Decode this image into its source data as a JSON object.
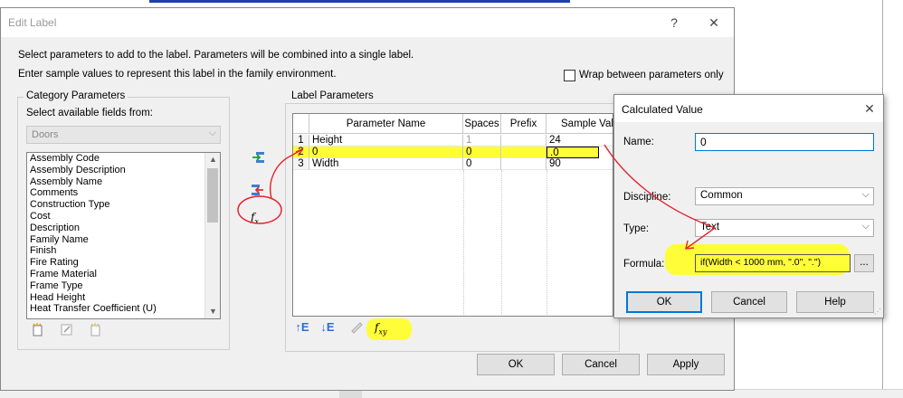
{
  "edit_label": {
    "title": "Edit Label",
    "help_glyph": "?",
    "close_glyph": "✕",
    "instruction1": "Select parameters to add to the label.  Parameters will be combined into a single label.",
    "instruction2": "Enter sample values to represent this label in the family environment.",
    "wrap_label": "Wrap between parameters only",
    "wrap_checked": false,
    "category_group": {
      "title": "Category Parameters",
      "select_label": "Select available fields from:",
      "category_value": "Doors",
      "fields": [
        "Assembly Code",
        "Assembly Description",
        "Assembly Name",
        "Comments",
        "Construction Type",
        "Cost",
        "Description",
        "Family Name",
        "Finish",
        "Fire Rating",
        "Frame Material",
        "Frame Type",
        "Head Height",
        "Heat Transfer Coefficient (U)"
      ]
    },
    "label_group": {
      "title": "Label Parameters",
      "columns": [
        "",
        "Parameter Name",
        "Spaces",
        "Prefix",
        "Sample Value"
      ],
      "rows": [
        {
          "num": "1",
          "name": "Height",
          "spaces": "1",
          "prefix": "",
          "sample": "24"
        },
        {
          "num": "2",
          "name": "0",
          "spaces": "0",
          "prefix": "",
          "sample": ".0"
        },
        {
          "num": "3",
          "name": "Width",
          "spaces": "0",
          "prefix": "",
          "sample": "90"
        }
      ]
    },
    "buttons": {
      "ok": "OK",
      "cancel": "Cancel",
      "apply": "Apply"
    }
  },
  "calc_value": {
    "title": "Calculated Value",
    "close_glyph": "✕",
    "name_label": "Name:",
    "name_value": "0",
    "discipline_label": "Discipline:",
    "discipline_value": "Common",
    "type_label": "Type:",
    "type_value": "Text",
    "formula_label": "Formula:",
    "formula_value": "if(Width < 1000 mm, \".0\", \".\")",
    "ellipsis": "...",
    "buttons": {
      "ok": "OK",
      "cancel": "Cancel",
      "help": "Help"
    }
  },
  "colors": {
    "highlight": "#fffd38",
    "annotation": "#e8202a",
    "accent": "#0078d7"
  }
}
